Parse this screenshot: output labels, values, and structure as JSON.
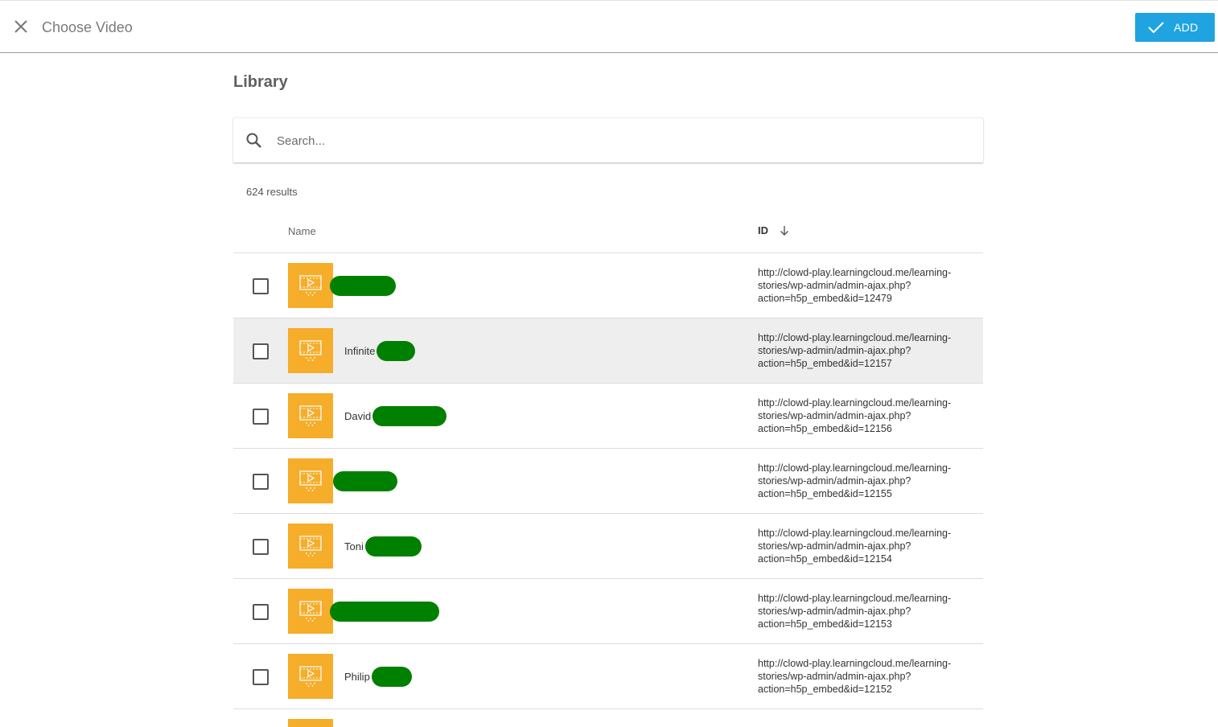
{
  "header": {
    "title": "Choose Video",
    "add_label": "ADD",
    "colors": {
      "add_button": "#1fa4e1"
    }
  },
  "library": {
    "title": "Library",
    "search": {
      "placeholder": "Search...",
      "value": ""
    },
    "results_count": "624 results",
    "columns": {
      "name": "Name",
      "id": "ID"
    },
    "thumbnail_color": "#f5ad2a",
    "redaction_color": "#008000",
    "rows": [
      {
        "name": "",
        "redacted": true,
        "hovered": false,
        "checked": false,
        "id": "http://clowd-play.learningcloud.me/learning-stories/wp-admin/admin-ajax.php?action=h5p_embed&id=12479"
      },
      {
        "name": "Infinite",
        "redacted": true,
        "hovered": true,
        "checked": false,
        "id": "http://clowd-play.learningcloud.me/learning-stories/wp-admin/admin-ajax.php?action=h5p_embed&id=12157"
      },
      {
        "name": "David",
        "redacted": true,
        "hovered": false,
        "checked": false,
        "id": "http://clowd-play.learningcloud.me/learning-stories/wp-admin/admin-ajax.php?action=h5p_embed&id=12156"
      },
      {
        "name": "",
        "redacted": true,
        "hovered": false,
        "checked": false,
        "id": "http://clowd-play.learningcloud.me/learning-stories/wp-admin/admin-ajax.php?action=h5p_embed&id=12155"
      },
      {
        "name": "Toni",
        "redacted": true,
        "hovered": false,
        "checked": false,
        "id": "http://clowd-play.learningcloud.me/learning-stories/wp-admin/admin-ajax.php?action=h5p_embed&id=12154"
      },
      {
        "name": "",
        "redacted": true,
        "hovered": false,
        "checked": false,
        "id": "http://clowd-play.learningcloud.me/learning-stories/wp-admin/admin-ajax.php?action=h5p_embed&id=12153"
      },
      {
        "name": "Philip",
        "redacted": true,
        "hovered": false,
        "checked": false,
        "id": "http://clowd-play.learningcloud.me/learning-stories/wp-admin/admin-ajax.php?action=h5p_embed&id=12152"
      }
    ]
  },
  "icons": {
    "close": "close-icon",
    "add": "checkmark-icon",
    "search": "search-icon",
    "sort": "arrow-down-icon",
    "thumbnail": "video-icon"
  }
}
